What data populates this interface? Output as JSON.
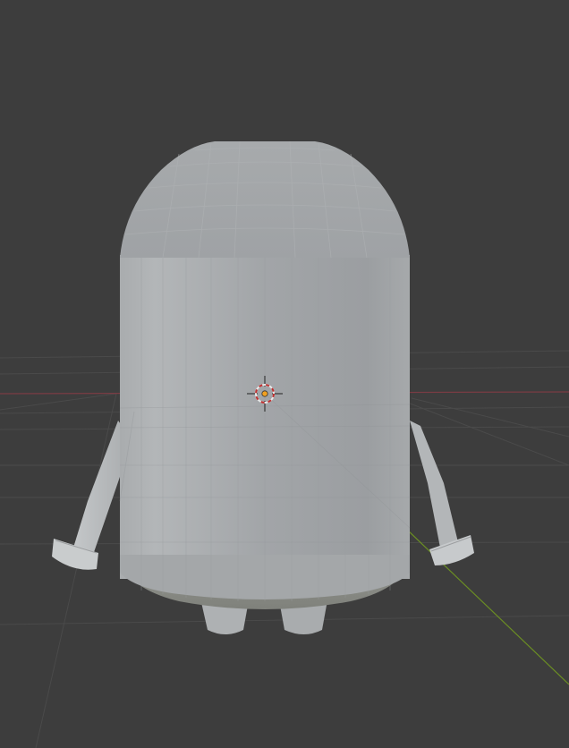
{
  "viewport": {
    "background_color": "#3d3d3d",
    "grid_color": "#4a4a4a",
    "x_axis_color": "#7a3c44",
    "y_axis_color": "#6b8e23"
  },
  "model": {
    "body_color": "#a3a6a9",
    "shadow_color": "#8a8c85",
    "highlight_color": "#b8bbbd"
  },
  "origin": {
    "ring_color": "#d8d8d8",
    "dash_color": "#c03030",
    "dot_color": "#f0a020"
  },
  "icons": {
    "origin_marker": "crosshair-icon"
  }
}
